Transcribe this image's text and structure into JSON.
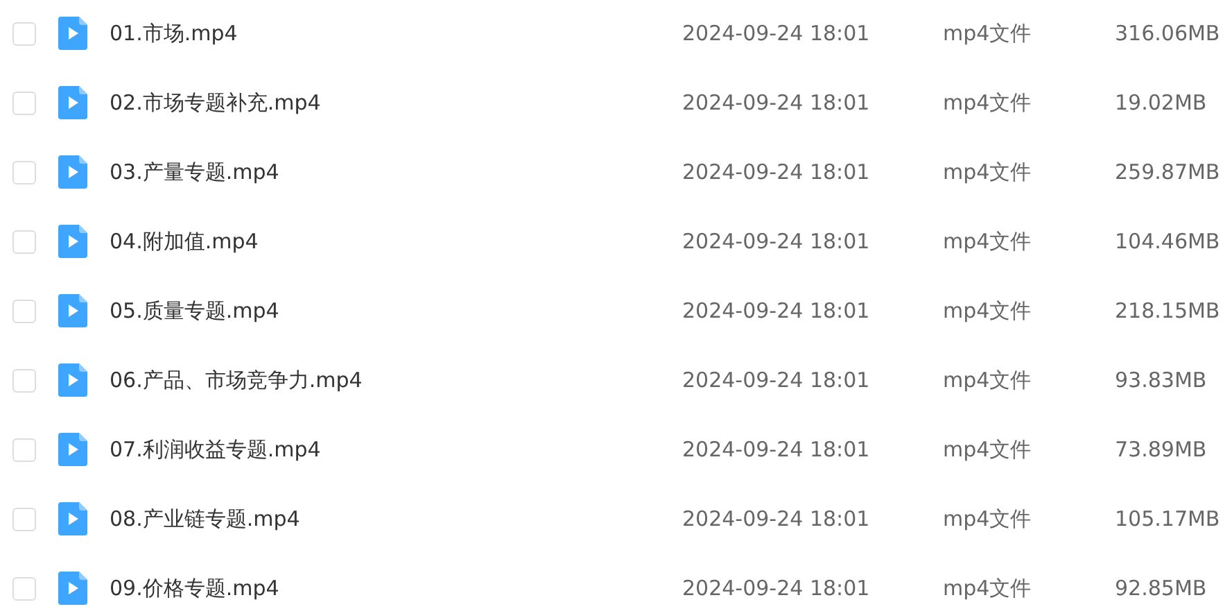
{
  "files": [
    {
      "name": "01.市场.mp4",
      "date": "2024-09-24 18:01",
      "type": "mp4文件",
      "size": "316.06MB",
      "checked": false
    },
    {
      "name": "02.市场专题补充.mp4",
      "date": "2024-09-24 18:01",
      "type": "mp4文件",
      "size": "19.02MB",
      "checked": false
    },
    {
      "name": "03.产量专题.mp4",
      "date": "2024-09-24 18:01",
      "type": "mp4文件",
      "size": "259.87MB",
      "checked": false
    },
    {
      "name": "04.附加值.mp4",
      "date": "2024-09-24 18:01",
      "type": "mp4文件",
      "size": "104.46MB",
      "checked": false
    },
    {
      "name": "05.质量专题.mp4",
      "date": "2024-09-24 18:01",
      "type": "mp4文件",
      "size": "218.15MB",
      "checked": false
    },
    {
      "name": "06.产品、市场竞争力.mp4",
      "date": "2024-09-24 18:01",
      "type": "mp4文件",
      "size": "93.83MB",
      "checked": false
    },
    {
      "name": "07.利润收益专题.mp4",
      "date": "2024-09-24 18:01",
      "type": "mp4文件",
      "size": "73.89MB",
      "checked": false
    },
    {
      "name": "08.产业链专题.mp4",
      "date": "2024-09-24 18:01",
      "type": "mp4文件",
      "size": "105.17MB",
      "checked": false
    },
    {
      "name": "09.价格专题.mp4",
      "date": "2024-09-24 18:01",
      "type": "mp4文件",
      "size": "92.85MB",
      "checked": false
    }
  ]
}
